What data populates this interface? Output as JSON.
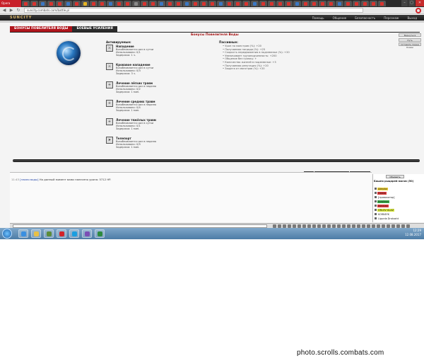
{
  "browser": {
    "logo": "Opera",
    "tab_colors": [
      "#d9332f",
      "#d9332f",
      "#3b78c4",
      "#d9332f",
      "#d9332f",
      "#3b78c4",
      "#d9332f",
      "#e6b422",
      "#d9332f",
      "#d9332f",
      "#3b78c4",
      "#d9332f",
      "#d9332f",
      "#8a8a8a",
      "#d9332f",
      "#d9332f",
      "#3b78c4",
      "#d9332f",
      "#d9332f",
      "#3b78c4",
      "#d9332f",
      "#d9332f",
      "#d9332f",
      "#3b78c4",
      "#d9332f",
      "#d9332f",
      "#d9332f",
      "#3b78c4",
      "#d9332f",
      "#d9332f",
      "#d9332f",
      "#d9332f",
      "#3b78c4",
      "#d9332f",
      "#d9332f",
      "#d9332f",
      "#d9332f",
      "#3b78c4",
      "#d9332f",
      "#d9332f",
      "#d9332f",
      "#d9332f",
      "#d9332f"
    ],
    "url": "suncity.combats.com/battle.pl",
    "window_buttons": [
      "–",
      "▢",
      "✕"
    ]
  },
  "game": {
    "logo": "SUNCITY",
    "top_menu": [
      "Помощь",
      "Общение",
      "Безопасность",
      "Персонаж",
      "Выход"
    ],
    "tabs": [
      {
        "label": "БОНУСЫ ПОВЕЛИТЕЛЯ ВОДЫ",
        "active": true
      },
      {
        "label": "БОЕВЫЕ УСИЛЕНИЯ",
        "active": false
      }
    ],
    "panel_title": "Бонусы Повелителя Воды",
    "right_buttons": [
      "Вернуться",
      "Путь",
      "Оставить перед боями"
    ],
    "accent_color": "#b0151c",
    "active": {
      "heading": "Активируемые:",
      "abilities": [
        {
          "icon": "⚔",
          "name": "Нападение",
          "lines": [
            "Возобновляется раз в сутки",
            "Использовано: 0/1",
            "Задержка: 1 ч."
          ]
        },
        {
          "icon": "⚔",
          "name": "Кровавое нападение",
          "lines": [
            "Возобновляется раз в сутки",
            "Использовано: 0/3",
            "Задержка: 3 ч."
          ]
        },
        {
          "icon": "+",
          "name": "Лечение лёгких травм",
          "lines": [
            "Возобновляется раз в неделю",
            "Использовано: 0/2",
            "Задержка: 1 мин."
          ]
        },
        {
          "icon": "+",
          "name": "Лечение средних травм",
          "lines": [
            "Возобновляется раз в неделю",
            "Использовано: 0/4",
            "Задержка: 1 мин."
          ]
        },
        {
          "icon": "+",
          "name": "Лечение тяжёлых травм",
          "lines": [
            "Возобновляется раз в сутки",
            "Использовано: 0/1",
            "Задержка: 1 мин."
          ]
        },
        {
          "icon": "➤",
          "name": "Телепорт",
          "lines": [
            "Возобновляется раз в неделю",
            "Использовано: 0/9",
            "Задержка: 1 мин."
          ]
        }
      ]
    },
    "passive": {
      "heading": "Пассивные:",
      "items": [
        "• Урон по монстрам (%): +20",
        "• Получаемая награда (%): +25",
        "• Скорость передвижения в подземелье (%): +20",
        "• Увеличивает грузоподъемность: +200",
        "• Общение без границ: +",
        "• Количество жизней в подземелье: +3",
        "• Получаемая репутация (%): +20",
        "• Защита от монстров (%): +20"
      ]
    }
  },
  "chat": {
    "tabs": [
      "Чат",
      "Системные сообщения",
      "Конфликты"
    ],
    "messages": [
      {
        "time": "11:43",
        "nick": "[знамя воды]",
        "text": "На данный момент вами нанесено урона: 5712 HP."
      }
    ],
    "sidebar": {
      "refresh_label": "Обновить",
      "room": "Башня рыцарей магов (50)",
      "players": [
        {
          "name": "Adeptor",
          "color": "#f1d33a"
        },
        {
          "name": "Diablo",
          "color": "#e23b3b"
        },
        {
          "name": "[провокатор]",
          "color": "#ffffff"
        },
        {
          "name": "Bowlieon",
          "color": "#3bb34a"
        },
        {
          "name": "Ironclad",
          "color": "#e23b3b"
        },
        {
          "name": "ORLOV GLAZ",
          "color": "#d9e83b"
        },
        {
          "name": "KORNEYK",
          "color": "#ffffff"
        },
        {
          "name": "Ligurda Drakosht",
          "color": "#ffffff"
        }
      ]
    }
  },
  "taskbar": {
    "apps": [
      {
        "name": "ie",
        "color": "#3a8fe0"
      },
      {
        "name": "explorer",
        "color": "#e8c046"
      },
      {
        "name": "media",
        "color": "#5b8c3a"
      },
      {
        "name": "opera",
        "color": "#d2232a"
      },
      {
        "name": "skype",
        "color": "#1a9ee0"
      },
      {
        "name": "viber",
        "color": "#7b4fb5"
      },
      {
        "name": "excel",
        "color": "#2d8a3e"
      }
    ],
    "time": "12:29",
    "date": "12.08.2017"
  },
  "watermark": "photo.scrolls.combats.com"
}
